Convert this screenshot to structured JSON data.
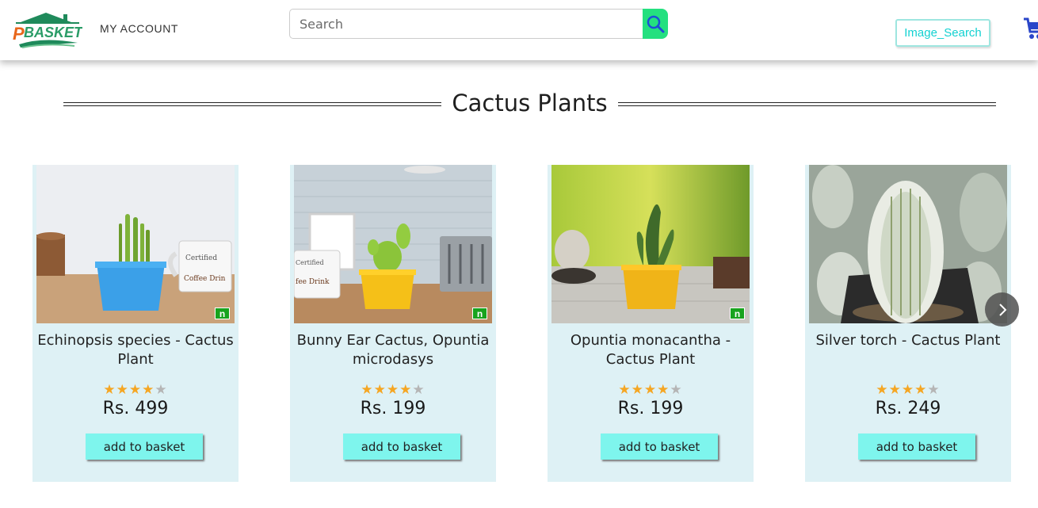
{
  "header": {
    "logo_text": "PBASKET",
    "my_account": "MY ACCOUNT",
    "search": {
      "placeholder": "Search",
      "value": ""
    },
    "image_search_label": "Image_Search"
  },
  "section": {
    "title": "Cactus Plants"
  },
  "products": [
    {
      "name": "Echinopsis species - Cactus Plant",
      "rating": 4,
      "price": "Rs. 499",
      "button": "add to basket",
      "badge": "n"
    },
    {
      "name": "Bunny Ear Cactus, Opuntia microdasys",
      "rating": 4,
      "price": "Rs. 199",
      "button": "add to basket",
      "badge": "n"
    },
    {
      "name": "Opuntia monacantha - Cactus Plant",
      "rating": 4,
      "price": "Rs. 199",
      "button": "add to basket",
      "badge": "n"
    },
    {
      "name": "Silver torch - Cactus Plant",
      "rating": 4,
      "price": "Rs. 249",
      "button": "add to basket",
      "badge": ""
    }
  ],
  "colors": {
    "accent": "#24e07f",
    "button": "#7ef5ed",
    "card_bg": "#def1f5",
    "star": "#f5a623",
    "image_search_text": "#12d1d1"
  },
  "icons": {
    "search": "search-icon",
    "cart": "cart-icon",
    "next": "chevron-right-icon"
  }
}
